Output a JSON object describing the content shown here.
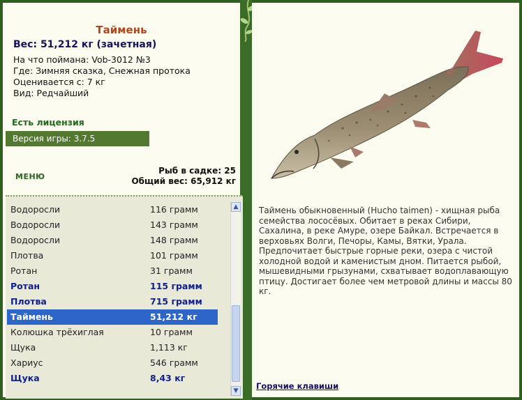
{
  "fish": {
    "title": "Таймень",
    "weight": "Вес: 51,212 кг (зачетная)",
    "info": [
      "На что поймана: Vob-3012 №3",
      "Где: Зимняя сказка, Снежная протока",
      "Оценивается с: 7 кг",
      "Вид: Редчайший"
    ],
    "license": "Есть лицензия",
    "description": "Таймень обыкновенный (Hucho taimen) - хищная рыба семейства лососёвых. Обитает в реках Сибири, Сахалина, в реке Амуре, озере Байкал. Встречается в верховьях Волги, Печоры, Камы, Вятки, Урала. Предпочитает быстрые горные реки, озера с чистой холодной водой и каменистым дном. Питается рыбой, мышевидными грызунами, схватывает водоплавающую птицу. Достигает более чем метровой длины и массы 80 кг."
  },
  "version": "Версия игры: 3.7.5",
  "menu_label": "МЕНЮ",
  "sadok": {
    "count": "Рыб в садке: 25",
    "total": "Общий вес: 65,912 кг"
  },
  "catch_list": [
    {
      "name": "Водоросли",
      "weight": "116 грамм",
      "style": "normal"
    },
    {
      "name": "Водоросли",
      "weight": "143 грамм",
      "style": "normal"
    },
    {
      "name": "Водоросли",
      "weight": "148 грамм",
      "style": "normal"
    },
    {
      "name": "Плотва",
      "weight": "101 грамм",
      "style": "normal"
    },
    {
      "name": "Ротан",
      "weight": "31 грамм",
      "style": "normal"
    },
    {
      "name": "Ротан",
      "weight": "115 грамм",
      "style": "bold"
    },
    {
      "name": "Плотва",
      "weight": "715 грамм",
      "style": "bold"
    },
    {
      "name": "Таймень",
      "weight": "51,212 кг",
      "style": "selected"
    },
    {
      "name": "Колюшка трёхиглая",
      "weight": "10 грамм",
      "style": "normal"
    },
    {
      "name": "Щука",
      "weight": "1,113 кг",
      "style": "normal"
    },
    {
      "name": "Хариус",
      "weight": "546 грамм",
      "style": "normal"
    },
    {
      "name": "Щука",
      "weight": "8,43 кг",
      "style": "bold"
    }
  ],
  "hotkeys_link": "Горячие клавиши",
  "colors": {
    "frame": "#2f5f1e",
    "panel": "#fbfbf0",
    "title": "#b4461c",
    "highlight_row": "#2e66c8",
    "bold_row": "#12208c"
  }
}
